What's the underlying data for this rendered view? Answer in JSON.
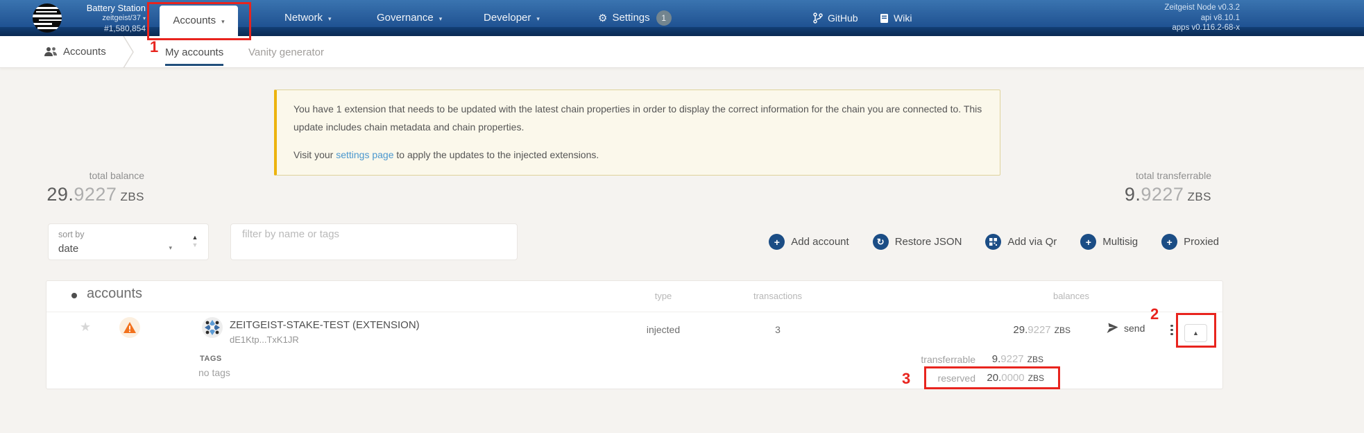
{
  "header": {
    "chain": {
      "name": "Battery Station",
      "network": "zeitgeist/37",
      "block": "#1,580,854"
    },
    "nav": [
      {
        "label": "Accounts"
      },
      {
        "label": "Network"
      },
      {
        "label": "Governance"
      },
      {
        "label": "Developer"
      },
      {
        "label": "Settings",
        "badge": "1"
      }
    ],
    "links": [
      {
        "label": "GitHub"
      },
      {
        "label": "Wiki"
      }
    ],
    "version": {
      "node": "Zeitgeist Node v0.3.2",
      "api": "api v8.10.1",
      "apps": "apps v0.116.2-68-x"
    }
  },
  "subnav": {
    "section": "Accounts",
    "tabs": [
      {
        "label": "My accounts"
      },
      {
        "label": "Vanity generator"
      }
    ]
  },
  "banner": {
    "line1": "You have 1 extension that needs to be updated with the latest chain properties in order to display the correct information for the chain you are connected to. This update includes chain metadata and chain properties.",
    "line2_prefix": "Visit your ",
    "line2_link": "settings page",
    "line2_suffix": " to apply the updates to the injected extensions."
  },
  "summary": {
    "total_balance_label": "total balance",
    "total_balance_int": "29.",
    "total_balance_frac": "9227",
    "total_balance_unit": "ZBS",
    "total_transferrable_label": "total transferrable",
    "total_transferrable_int": "9.",
    "total_transferrable_frac": "9227",
    "total_transferrable_unit": "ZBS"
  },
  "toolbar": {
    "sort_label": "sort by",
    "sort_value": "date",
    "filter_placeholder": "filter by name or tags",
    "buttons": [
      "Add account",
      "Restore JSON",
      "Add via Qr",
      "Multisig",
      "Proxied"
    ]
  },
  "table": {
    "title": "accounts",
    "columns": {
      "type": "type",
      "transactions": "transactions",
      "balances": "balances"
    },
    "row": {
      "name": "ZEITGEIST-STAKE-TEST (EXTENSION)",
      "address": "dE1Ktp...TxK1JR",
      "type": "injected",
      "transactions": "3",
      "balance_int": "29.",
      "balance_frac": "9227",
      "balance_unit": "ZBS",
      "send_label": "send",
      "tags_label": "TAGS",
      "tags_value": "no tags",
      "details": [
        {
          "label": "transferrable",
          "int": "9.",
          "frac": "9227",
          "unit": "ZBS"
        },
        {
          "label": "reserved",
          "int": "20.",
          "frac": "0000",
          "unit": "ZBS"
        }
      ]
    }
  },
  "annotations": {
    "one": "1",
    "two": "2",
    "three": "3"
  },
  "colors": {
    "accent_blue": "#1b4d85",
    "annotation_red": "#e8241e",
    "warning_orange": "#f2711c",
    "banner_border": "#ecb30e"
  }
}
